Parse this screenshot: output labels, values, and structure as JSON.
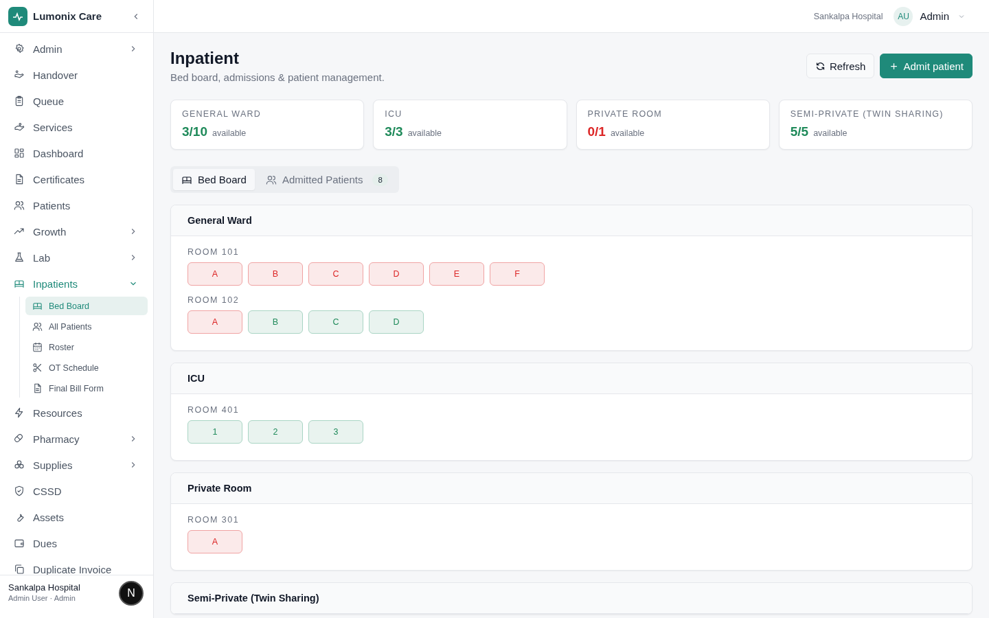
{
  "brand": {
    "name": "Lumonix Care"
  },
  "sidebar": {
    "items": [
      {
        "label": "Admin",
        "selected": false,
        "expanded": false
      },
      {
        "label": "Handover",
        "selected": false
      },
      {
        "label": "Queue",
        "selected": false
      },
      {
        "label": "Services",
        "selected": false
      },
      {
        "label": "Dashboard",
        "selected": false
      },
      {
        "label": "Certificates",
        "selected": false
      },
      {
        "label": "Patients",
        "selected": false
      },
      {
        "label": "Growth",
        "selected": false,
        "expanded": false
      },
      {
        "label": "Lab",
        "selected": false,
        "expanded": false
      },
      {
        "label": "Inpatients",
        "selected": true,
        "expanded": true,
        "children": [
          {
            "label": "Bed Board",
            "selected": true
          },
          {
            "label": "All Patients",
            "selected": false
          },
          {
            "label": "Roster",
            "selected": false
          },
          {
            "label": "OT Schedule",
            "selected": false
          },
          {
            "label": "Final Bill Form",
            "selected": false
          }
        ]
      },
      {
        "label": "Resources",
        "selected": false
      },
      {
        "label": "Pharmacy",
        "selected": false,
        "expanded": false
      },
      {
        "label": "Supplies",
        "selected": false,
        "expanded": false
      },
      {
        "label": "CSSD",
        "selected": false
      },
      {
        "label": "Assets",
        "selected": false
      },
      {
        "label": "Dues",
        "selected": false
      },
      {
        "label": "Duplicate Invoice",
        "selected": false
      }
    ],
    "footer": {
      "org": "Sankalpa Hospital",
      "user": "Admin User · Admin",
      "badge": "N"
    }
  },
  "header": {
    "hospital": "Sankalpa Hospital",
    "avatar": "AU",
    "user": "Admin"
  },
  "page": {
    "title": "Inpatient",
    "subtitle": "Bed board, admissions & patient management.",
    "buttons": [
      {
        "label": "Refresh",
        "kind": "secondary"
      },
      {
        "label": "Admit patient",
        "kind": "primary"
      }
    ]
  },
  "stats": [
    {
      "label": "GENERAL WARD",
      "value": "3/10",
      "caption": "available",
      "full": false
    },
    {
      "label": "ICU",
      "value": "3/3",
      "caption": "available",
      "full": false
    },
    {
      "label": "PRIVATE ROOM",
      "value": "0/1",
      "caption": "available",
      "full": true
    },
    {
      "label": "SEMI-PRIVATE (TWIN SHARING)",
      "value": "5/5",
      "caption": "available",
      "full": false
    }
  ],
  "tabs": [
    {
      "label": "Bed Board",
      "selected": true
    },
    {
      "label": "Admitted Patients",
      "selected": false,
      "count": "8"
    }
  ],
  "wards": [
    {
      "name": "General Ward",
      "rooms": [
        {
          "name": "ROOM 101",
          "beds": [
            {
              "label": "A",
              "occupied": true
            },
            {
              "label": "B",
              "occupied": true
            },
            {
              "label": "C",
              "occupied": true
            },
            {
              "label": "D",
              "occupied": true
            },
            {
              "label": "E",
              "occupied": true
            },
            {
              "label": "F",
              "occupied": true
            }
          ]
        },
        {
          "name": "ROOM 102",
          "beds": [
            {
              "label": "A",
              "occupied": true
            },
            {
              "label": "B",
              "occupied": false
            },
            {
              "label": "C",
              "occupied": false
            },
            {
              "label": "D",
              "occupied": false
            }
          ]
        }
      ]
    },
    {
      "name": "ICU",
      "rooms": [
        {
          "name": "ROOM 401",
          "beds": [
            {
              "label": "1",
              "occupied": false
            },
            {
              "label": "2",
              "occupied": false
            },
            {
              "label": "3",
              "occupied": false
            }
          ]
        }
      ]
    },
    {
      "name": "Private Room",
      "rooms": [
        {
          "name": "ROOM 301",
          "beds": [
            {
              "label": "A",
              "occupied": true
            }
          ]
        }
      ]
    },
    {
      "name": "Semi-Private (Twin Sharing)"
    }
  ]
}
